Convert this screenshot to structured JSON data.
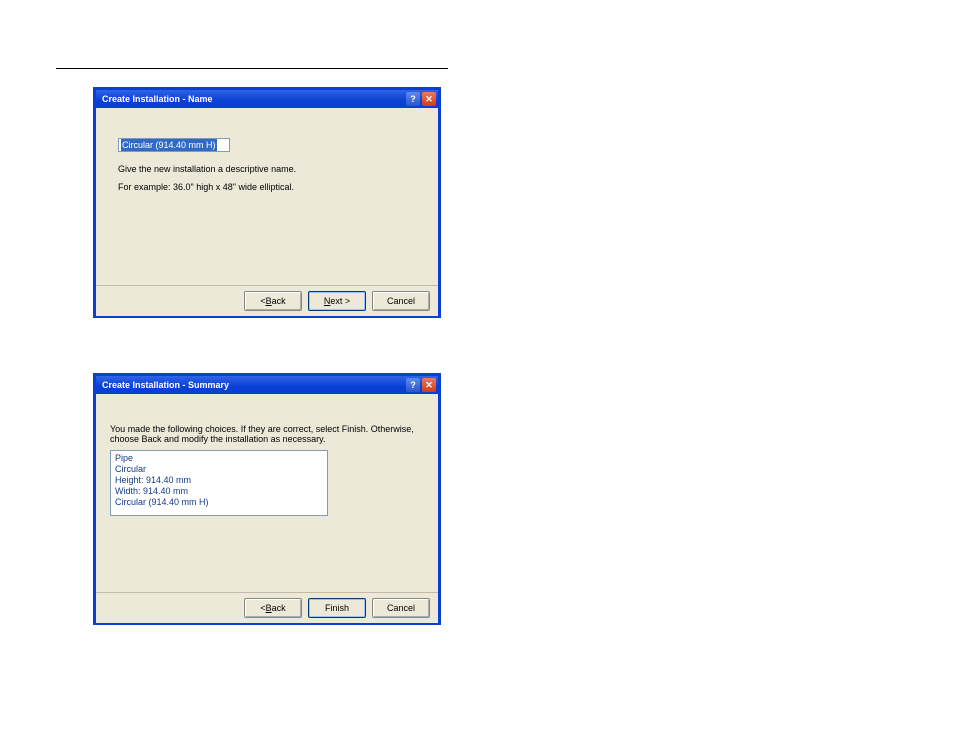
{
  "dialog1": {
    "title": "Create Installation - Name",
    "input_value": "Circular (914.40 mm H)",
    "line1": "Give the new installation a descriptive name.",
    "line2": "For example: 36.0\" high x 48\" wide elliptical.",
    "back_prefix": "< ",
    "back_u": "B",
    "back_rest": "ack",
    "next_u": "N",
    "next_rest": "ext >",
    "cancel": "Cancel",
    "help_glyph": "?",
    "close_glyph": "✕"
  },
  "dialog2": {
    "title": "Create Installation - Summary",
    "intro1": "You made the following choices.  If they are correct, select Finish.  Otherwise,",
    "intro2": "choose Back and modify the installation as necessary.",
    "summary": {
      "l0": "Pipe",
      "l1": "Circular",
      "l2": "Height: 914.40 mm",
      "l3": "Width: 914.40 mm",
      "l4": "Circular (914.40 mm H)"
    },
    "back_prefix": "< ",
    "back_u": "B",
    "back_rest": "ack",
    "finish": "Finish",
    "cancel": "Cancel",
    "help_glyph": "?",
    "close_glyph": "✕"
  }
}
